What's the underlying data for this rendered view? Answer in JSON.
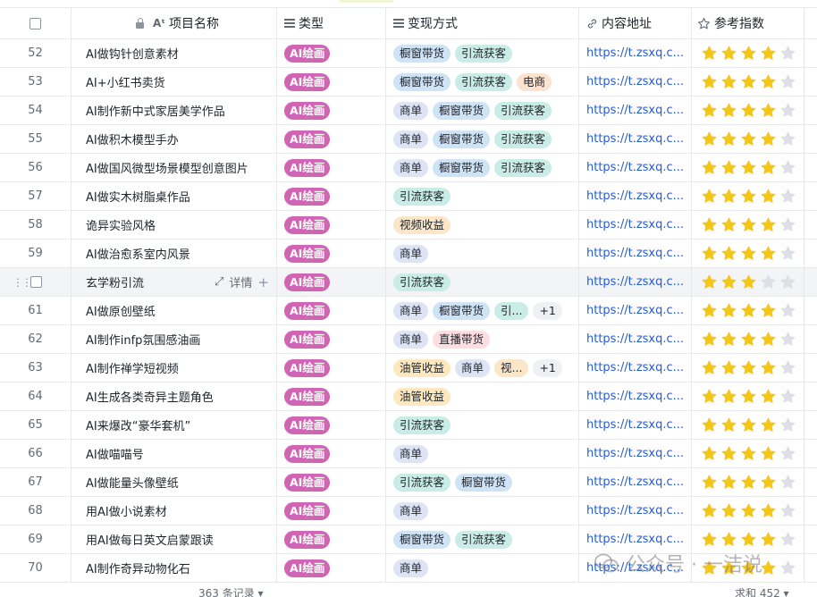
{
  "header": {
    "name": "项目名称",
    "type": "类型",
    "way": "变现方式",
    "url": "内容地址",
    "rating": "参考指数"
  },
  "rows": [
    {
      "idx": "52",
      "name": "AI做钩针创意素材",
      "type": "AI绘画",
      "tags": [
        {
          "text": "橱窗带货",
          "cls": "t-chuchuang"
        },
        {
          "text": "引流获客",
          "cls": "t-yinliu"
        }
      ],
      "url": "https://t.zsxq.c...",
      "stars": 4
    },
    {
      "idx": "53",
      "name": "AI+小红书卖货",
      "type": "AI绘画",
      "tags": [
        {
          "text": "橱窗带货",
          "cls": "t-chuchuang"
        },
        {
          "text": "引流获客",
          "cls": "t-yinliu"
        },
        {
          "text": "电商",
          "cls": "t-dianshang"
        }
      ],
      "url": "https://t.zsxq.c...",
      "stars": 4
    },
    {
      "idx": "54",
      "name": "AI制作新中式家居美学作品",
      "type": "AI绘画",
      "tags": [
        {
          "text": "商单",
          "cls": "t-shangdan"
        },
        {
          "text": "橱窗带货",
          "cls": "t-chuchuang"
        },
        {
          "text": "引流获客",
          "cls": "t-yinliu"
        }
      ],
      "url": "https://t.zsxq.c...",
      "stars": 4
    },
    {
      "idx": "55",
      "name": "AI做积木模型手办",
      "type": "AI绘画",
      "tags": [
        {
          "text": "商单",
          "cls": "t-shangdan"
        },
        {
          "text": "橱窗带货",
          "cls": "t-chuchuang"
        },
        {
          "text": "引流获客",
          "cls": "t-yinliu"
        }
      ],
      "url": "https://t.zsxq.c...",
      "stars": 4
    },
    {
      "idx": "56",
      "name": "AI做国风微型场景模型创意图片",
      "type": "AI绘画",
      "tags": [
        {
          "text": "商单",
          "cls": "t-shangdan"
        },
        {
          "text": "橱窗带货",
          "cls": "t-chuchuang"
        },
        {
          "text": "引流获客",
          "cls": "t-yinliu"
        }
      ],
      "url": "https://t.zsxq.c...",
      "stars": 4
    },
    {
      "idx": "57",
      "name": "AI做实木树脂桌作品",
      "type": "AI绘画",
      "tags": [
        {
          "text": "引流获客",
          "cls": "t-yinliu"
        }
      ],
      "url": "https://t.zsxq.c...",
      "stars": 4
    },
    {
      "idx": "58",
      "name": "诡异实验风格",
      "type": "AI绘画",
      "tags": [
        {
          "text": "视频收益",
          "cls": "t-shipin"
        }
      ],
      "url": "https://t.zsxq.c...",
      "stars": 4
    },
    {
      "idx": "59",
      "name": "AI做治愈系室内风景",
      "type": "AI绘画",
      "tags": [
        {
          "text": "商单",
          "cls": "t-shangdan"
        }
      ],
      "url": "https://t.zsxq.c...",
      "stars": 4
    },
    {
      "idx": "",
      "name": "玄学粉引流",
      "type": "AI绘画",
      "tags": [
        {
          "text": "引流获客",
          "cls": "t-yinliu"
        }
      ],
      "url": "https://t.zsxq.c...",
      "stars": 3,
      "hover": true,
      "detail": "详情"
    },
    {
      "idx": "61",
      "name": "AI做原创壁纸",
      "type": "AI绘画",
      "tags": [
        {
          "text": "商单",
          "cls": "t-shangdan"
        },
        {
          "text": "橱窗带货",
          "cls": "t-chuchuang"
        },
        {
          "text": "引...",
          "cls": "t-yinliu"
        },
        {
          "text": "+1",
          "cls": "t-more"
        }
      ],
      "url": "https://t.zsxq.c...",
      "stars": 4
    },
    {
      "idx": "62",
      "name": "AI制作infp氛围感油画",
      "type": "AI绘画",
      "tags": [
        {
          "text": "商单",
          "cls": "t-shangdan"
        },
        {
          "text": "直播带货",
          "cls": "t-zhibo"
        }
      ],
      "url": "https://t.zsxq.c...",
      "stars": 4
    },
    {
      "idx": "63",
      "name": "AI制作禅学短视频",
      "type": "AI绘画",
      "tags": [
        {
          "text": "油管收益",
          "cls": "t-youguan"
        },
        {
          "text": "商单",
          "cls": "t-shangdan"
        },
        {
          "text": "视...",
          "cls": "t-shipin"
        },
        {
          "text": "+1",
          "cls": "t-more"
        }
      ],
      "url": "https://t.zsxq.c...",
      "stars": 4
    },
    {
      "idx": "64",
      "name": "AI生成各类奇异主题角色",
      "type": "AI绘画",
      "tags": [
        {
          "text": "油管收益",
          "cls": "t-youguan"
        }
      ],
      "url": "https://t.zsxq.c...",
      "stars": 4
    },
    {
      "idx": "65",
      "name": "AI来爆改“豪华套机”",
      "type": "AI绘画",
      "tags": [
        {
          "text": "引流获客",
          "cls": "t-yinliu"
        }
      ],
      "url": "https://t.zsxq.c...",
      "stars": 4
    },
    {
      "idx": "66",
      "name": "AI做喵喵号",
      "type": "AI绘画",
      "tags": [
        {
          "text": "商单",
          "cls": "t-shangdan"
        }
      ],
      "url": "https://t.zsxq.c...",
      "stars": 4
    },
    {
      "idx": "67",
      "name": "AI做能量头像壁纸",
      "type": "AI绘画",
      "tags": [
        {
          "text": "引流获客",
          "cls": "t-yinliu"
        },
        {
          "text": "橱窗带货",
          "cls": "t-chuchuang"
        }
      ],
      "url": "https://t.zsxq.c...",
      "stars": 4
    },
    {
      "idx": "68",
      "name": "用AI做小说素材",
      "type": "AI绘画",
      "tags": [
        {
          "text": "商单",
          "cls": "t-shangdan"
        }
      ],
      "url": "https://t.zsxq.c...",
      "stars": 4
    },
    {
      "idx": "69",
      "name": "用AI做每日英文启蒙跟读",
      "type": "AI绘画",
      "tags": [
        {
          "text": "橱窗带货",
          "cls": "t-chuchuang"
        },
        {
          "text": "引流获客",
          "cls": "t-yinliu"
        }
      ],
      "url": "https://t.zsxq.c...",
      "stars": 4
    },
    {
      "idx": "70",
      "name": "AI制作奇异动物化石",
      "type": "AI绘画",
      "tags": [
        {
          "text": "商单",
          "cls": "t-shangdan"
        }
      ],
      "url": "https://t.zsxq.c...",
      "stars": 4
    }
  ],
  "footer": {
    "count": "363 条记录 ▾",
    "sum": "求和 452 ▾"
  },
  "watermark": "公众号 · 一洁说",
  "colors": {
    "type_tag": "#d165b3",
    "star_on": "#f5c518",
    "star_off": "#dcdfe3",
    "link": "#245bdb"
  }
}
